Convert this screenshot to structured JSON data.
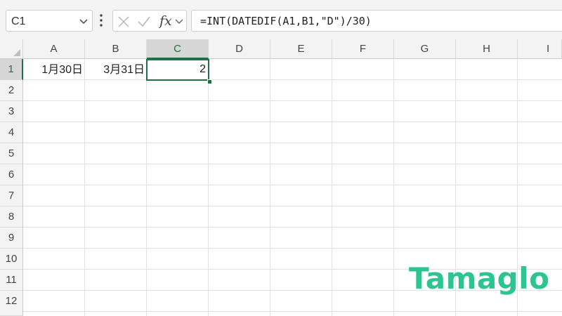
{
  "name_box": {
    "value": "C1"
  },
  "formula_bar": {
    "fx_label": "fx",
    "formula": "=INT(DATEDIF(A1,B1,\"D\")/30)"
  },
  "columns": [
    "A",
    "B",
    "C",
    "D",
    "E",
    "F",
    "G",
    "H",
    "I"
  ],
  "selected_column": "C",
  "rows": [
    "1",
    "2",
    "3",
    "4",
    "5",
    "6",
    "7",
    "8",
    "9",
    "10",
    "11",
    "12"
  ],
  "selected_row": "1",
  "cells": {
    "A1": "1月30日",
    "B1": "3月31日",
    "C1": "2"
  },
  "active_cell": "C1",
  "watermark": "Tamaglo",
  "colors": {
    "accent": "#1e7145",
    "logo": "#2ec48f"
  },
  "icons": [
    "chevron-down-icon",
    "more-vertical-icon",
    "cancel-x-icon",
    "check-icon",
    "function-icon"
  ]
}
